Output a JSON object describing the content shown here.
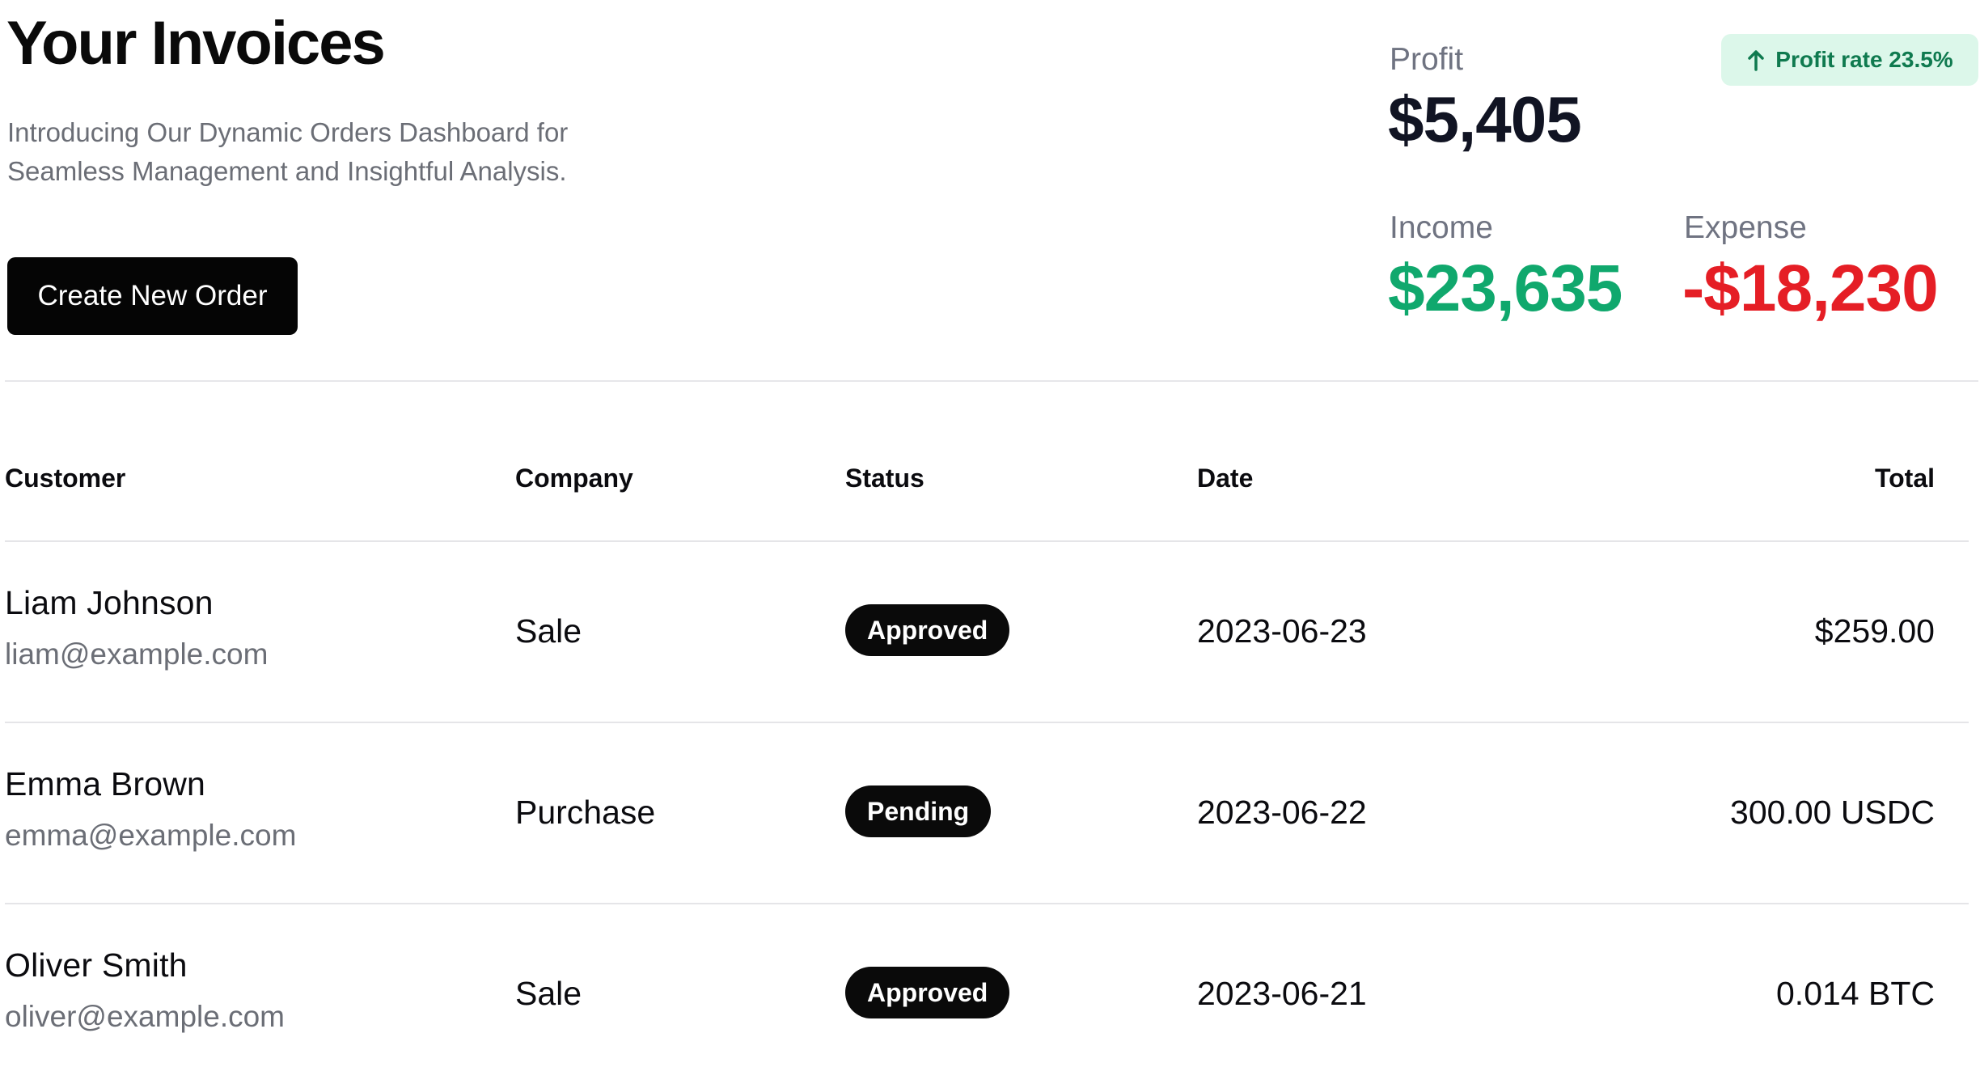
{
  "header": {
    "title": "Your Invoices",
    "subtitle_line1": "Introducing Our Dynamic Orders Dashboard for",
    "subtitle_line2": "Seamless Management and Insightful Analysis.",
    "create_button_label": "Create New Order"
  },
  "stats": {
    "profit_label": "Profit",
    "profit_value": "$5,405",
    "profit_rate_label": "Profit rate 23.5%",
    "profit_rate_icon": "arrow-up-icon",
    "income_label": "Income",
    "income_value": "$23,635",
    "expense_label": "Expense",
    "expense_value": "-$18,230",
    "colors": {
      "income": "#10a86d",
      "expense": "#e51e25",
      "badge_background": "#dcf7ea",
      "badge_text": "#0f7a4f"
    }
  },
  "table": {
    "columns": {
      "customer": "Customer",
      "company": "Company",
      "status": "Status",
      "date": "Date",
      "total": "Total"
    },
    "rows": [
      {
        "name": "Liam Johnson",
        "email": "liam@example.com",
        "company": "Sale",
        "status": "Approved",
        "date": "2023-06-23",
        "total": "$259.00"
      },
      {
        "name": "Emma Brown",
        "email": "emma@example.com",
        "company": "Purchase",
        "status": "Pending",
        "date": "2023-06-22",
        "total": "300.00 USDC"
      },
      {
        "name": "Oliver Smith",
        "email": "oliver@example.com",
        "company": "Sale",
        "status": "Approved",
        "date": "2023-06-21",
        "total": "0.014 BTC"
      }
    ]
  }
}
